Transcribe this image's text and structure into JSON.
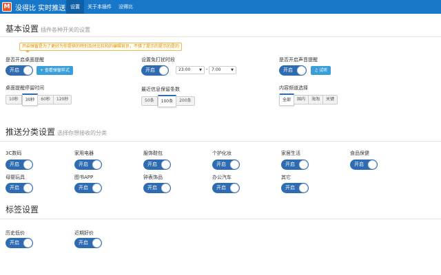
{
  "navbar": {
    "logo_text": "M",
    "brand": "没得比 实时推送",
    "items": [
      {
        "label": "设置",
        "active": true
      },
      {
        "label": "关于本插件",
        "active": false
      },
      {
        "label": "没得比",
        "active": false
      }
    ]
  },
  "basic": {
    "title": "基本设置",
    "subtitle": "插件各种开关的设置",
    "tooltip": "开启弹窗是为了更好为你提供的特别及时比较和的编辑官员，不错了提示的提示的是的",
    "desktop_notify": {
      "label": "是否开启桌面提醒",
      "state": "开启",
      "preview_button": "+ 查看弹窗样式"
    },
    "quiet_time": {
      "label": "设置免打扰时段",
      "state": "开启",
      "start": "23:00",
      "end": "7:00",
      "separator": "-"
    },
    "sound": {
      "label": "是否开启声音提醒",
      "state": "开启",
      "test_button": "♫ 试听"
    },
    "stay_time": {
      "label": "桌面提醒停留时间",
      "options": [
        "10秒",
        "30秒",
        "60秒",
        "120秒"
      ],
      "selected": "30秒"
    },
    "keep_count": {
      "label": "最近信息保留条数",
      "options": [
        "50条",
        "100条",
        "200条"
      ],
      "selected": "100条"
    },
    "channel": {
      "label": "内容频道选择",
      "options": [
        "全部",
        "国内",
        "海淘",
        "关键"
      ],
      "selected": "全部"
    }
  },
  "push": {
    "title": "推送分类设置",
    "subtitle": "选择你想接收的分类",
    "categories": [
      {
        "label": "3C数码",
        "state": "开启"
      },
      {
        "label": "家用电器",
        "state": "开启"
      },
      {
        "label": "服饰鞋包",
        "state": "开启"
      },
      {
        "label": "个护化妆",
        "state": "开启"
      },
      {
        "label": "家居生活",
        "state": "开启"
      },
      {
        "label": "食品保健",
        "state": "开启"
      },
      {
        "label": "母婴玩具",
        "state": "开启"
      },
      {
        "label": "图书APP",
        "state": "开启"
      },
      {
        "label": "钟表饰品",
        "state": "开启"
      },
      {
        "label": "办公汽车",
        "state": "开启"
      },
      {
        "label": "其它",
        "state": "开启"
      }
    ]
  },
  "tags": {
    "title": "标签设置",
    "items": [
      {
        "label": "历史低价",
        "state": "开启"
      },
      {
        "label": "近期好价",
        "state": "开启"
      }
    ]
  },
  "colors": {
    "navbar": "#1877c8",
    "toggle": "#2e6bb0",
    "button": "#3a9fd9",
    "tooltip_border": "#f0b84a"
  }
}
